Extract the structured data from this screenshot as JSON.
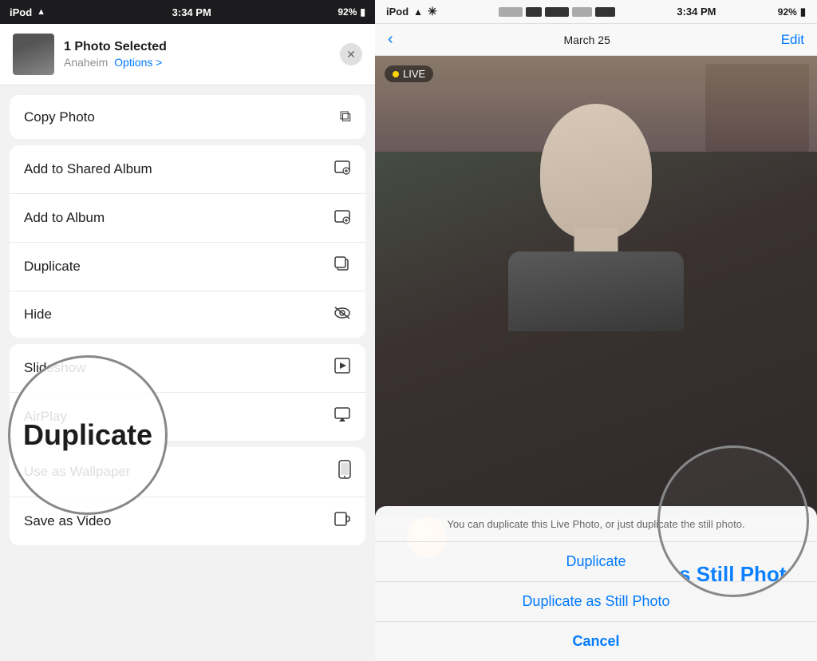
{
  "left": {
    "statusBar": {
      "carrier": "iPod",
      "time": "3:34 PM",
      "battery": "92%"
    },
    "shareHeader": {
      "title": "1 Photo Selected",
      "subtitle": "Anaheim",
      "optionsLabel": "Options >",
      "closeLabel": "✕"
    },
    "menuItems": [
      {
        "id": "copy-photo",
        "label": "Copy Photo",
        "icon": "⊡"
      },
      {
        "id": "add-shared-album",
        "label": "Add to Shared Album",
        "icon": "⊡"
      },
      {
        "id": "add-album",
        "label": "Add to Album",
        "icon": "⊡"
      },
      {
        "id": "duplicate",
        "label": "Duplicate",
        "icon": "⊡"
      },
      {
        "id": "hide",
        "label": "Hide",
        "icon": "⊘"
      },
      {
        "id": "slideshow",
        "label": "Slideshow",
        "icon": "▶"
      },
      {
        "id": "airplay",
        "label": "AirPlay",
        "icon": "▲"
      },
      {
        "id": "wallpaper",
        "label": "Use as Wallpaper",
        "icon": "📱"
      },
      {
        "id": "save-video",
        "label": "Save as Video",
        "icon": "🎬"
      }
    ],
    "circleLabel": "Duplicate"
  },
  "right": {
    "statusBar": {
      "carrier": "iPod",
      "time": "3:34 PM",
      "battery": "92%",
      "colorBlocks": [
        "#aaa",
        "#333",
        "#333",
        "#aaa",
        "#333"
      ]
    },
    "nav": {
      "backLabel": "‹",
      "dateLabel": "March 25",
      "editLabel": "Edit"
    },
    "liveBadge": "⊙ LIVE",
    "bottomSheet": {
      "message": "You can duplicate this Live Photo, or just\nduplicate the still photo.",
      "btn1": "Duplicate",
      "btn2": "Duplicate as Still Photo",
      "btnCancel": "Cancel"
    },
    "circleText": "as Still Photo"
  }
}
